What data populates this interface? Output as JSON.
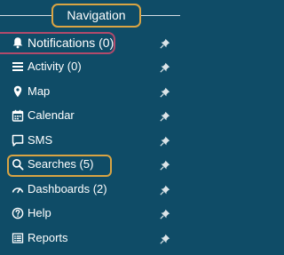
{
  "header": {
    "title": "Navigation"
  },
  "colors": {
    "background": "#0f4c67",
    "highlight_gold": "#d9a443",
    "highlight_red": "#b24a6b"
  },
  "nav": {
    "items": [
      {
        "icon": "bell-icon",
        "label": "Notifications (0)",
        "highlight": "red"
      },
      {
        "icon": "list-icon",
        "label": "Activity (0)"
      },
      {
        "icon": "map-pin-icon",
        "label": "Map"
      },
      {
        "icon": "calendar-icon",
        "label": "Calendar"
      },
      {
        "icon": "chat-icon",
        "label": "SMS"
      },
      {
        "icon": "search-icon",
        "label": "Searches (5)",
        "highlight": "gold"
      },
      {
        "icon": "gauge-icon",
        "label": "Dashboards (2)"
      },
      {
        "icon": "help-icon",
        "label": "Help"
      },
      {
        "icon": "report-icon",
        "label": "Reports"
      }
    ],
    "pin_icon": "pin-icon"
  }
}
